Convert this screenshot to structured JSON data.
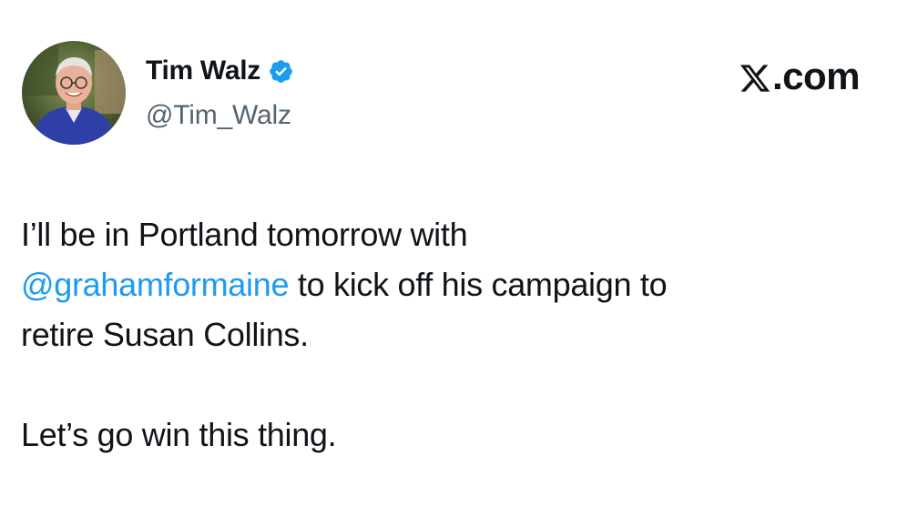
{
  "source": {
    "brand_label": ".com",
    "brand_icon": "x-logo-icon"
  },
  "author": {
    "display_name": "Tim Walz",
    "handle": "@Tim_Walz",
    "verified": true,
    "verified_color": "#1d9bf0",
    "avatar_icon": "profile-photo"
  },
  "tweet": {
    "line1": "I’ll be in Portland tomorrow with",
    "mention": "@grahamformaine",
    "line2_rest": " to kick off his campaign to",
    "line3": "retire Susan Collins.",
    "line4": "Let’s go win this thing."
  },
  "colors": {
    "text": "#0f1419",
    "secondary": "#536471",
    "link": "#1d9bf0",
    "background": "#ffffff"
  }
}
